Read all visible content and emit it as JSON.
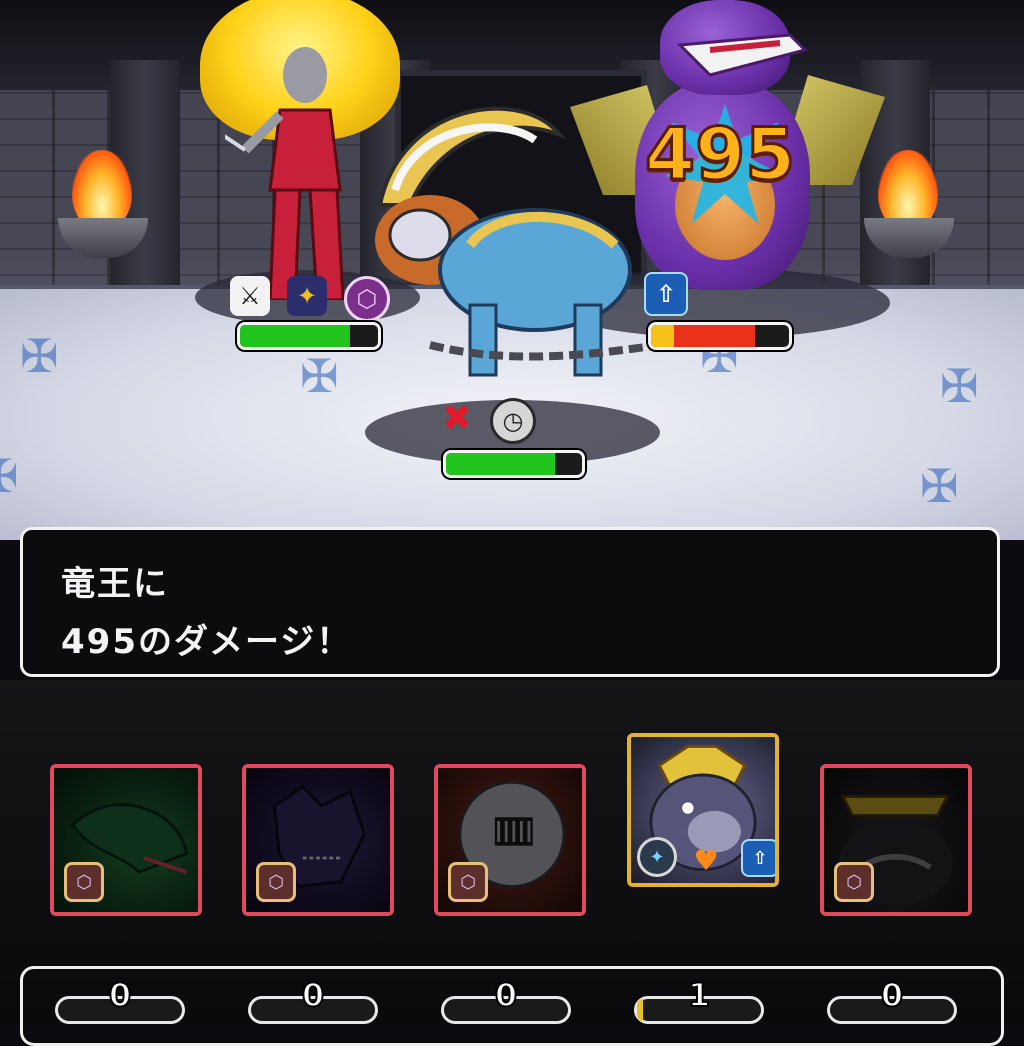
{
  "battle": {
    "damage_popup": "495",
    "allies": [
      {
        "name": "sorceress",
        "hp": 0.8,
        "hp_color": "#22c51e",
        "statuses": [
          "attack-up-paw-icon",
          "defense-up-paw-icon",
          "ward-icon"
        ]
      },
      {
        "name": "armored-beast",
        "hp": 0.8,
        "hp_color": "#22c51e",
        "statuses": [
          "cross-mark-icon",
          "clock-up-icon"
        ]
      }
    ],
    "enemy": {
      "name": "dragon",
      "hp": 0.75,
      "hp_color": "#e8331a",
      "hp_low_color": "#f5c21a",
      "statuses": [
        "attack-up-arrow-icon"
      ]
    }
  },
  "message": {
    "line1": "竜王に",
    "line2": "495のダメージ！"
  },
  "party": [
    {
      "name": "green-dragon",
      "active": false,
      "icons": [
        "ward-icon"
      ],
      "counter": "0",
      "counter_fill": 0
    },
    {
      "name": "dark-dragon",
      "active": false,
      "icons": [
        "ward-icon"
      ],
      "counter": "0",
      "counter_fill": 0
    },
    {
      "name": "knight-helm",
      "active": false,
      "icons": [
        "ward-icon"
      ],
      "counter": "0",
      "counter_fill": 0
    },
    {
      "name": "gorilla-king",
      "active": true,
      "icons": [
        "sparkle-icon",
        "heart-icon",
        "attack-up-arrow-icon"
      ],
      "counter": "1",
      "counter_fill": 0.05
    },
    {
      "name": "dark-king",
      "active": false,
      "icons": [
        "ward-icon"
      ],
      "counter": "0",
      "counter_fill": 0
    }
  ],
  "colors": {
    "accent_red": "#e04a5c",
    "accent_gold": "#e2b32e",
    "hp_green": "#22c51e"
  }
}
